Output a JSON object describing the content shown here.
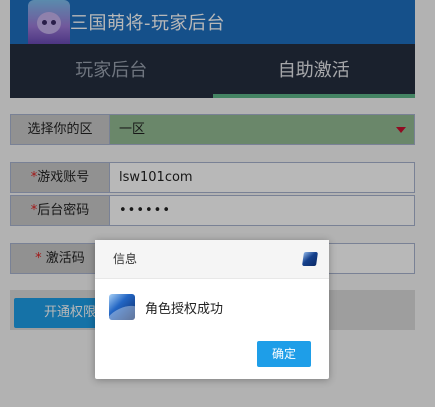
{
  "header": {
    "title": "三国萌将-玩家后台"
  },
  "tabs": [
    {
      "label": "玩家后台",
      "active": false
    },
    {
      "label": "自助激活",
      "active": true
    }
  ],
  "form": {
    "server": {
      "label": "选择你的区",
      "value": "一区"
    },
    "account": {
      "required_mark": "*",
      "label": "游戏账号",
      "value": "lsw101com"
    },
    "password": {
      "required_mark": "*",
      "label": "后台密码",
      "value": "••••••"
    },
    "code": {
      "required_mark": "*",
      "label": " 激活码",
      "value": ""
    }
  },
  "action": {
    "activate_label": "开通权限"
  },
  "dialog": {
    "title": "信息",
    "message": "角色授权成功",
    "ok_label": "确定"
  },
  "colors": {
    "header_bg": "#1e6fbf",
    "tabs_bg": "#252f3f",
    "active_underline": "#5fb88a",
    "select_bg": "#94bb94",
    "primary_button": "#1e9ee8",
    "required_mark": "#e02020"
  }
}
